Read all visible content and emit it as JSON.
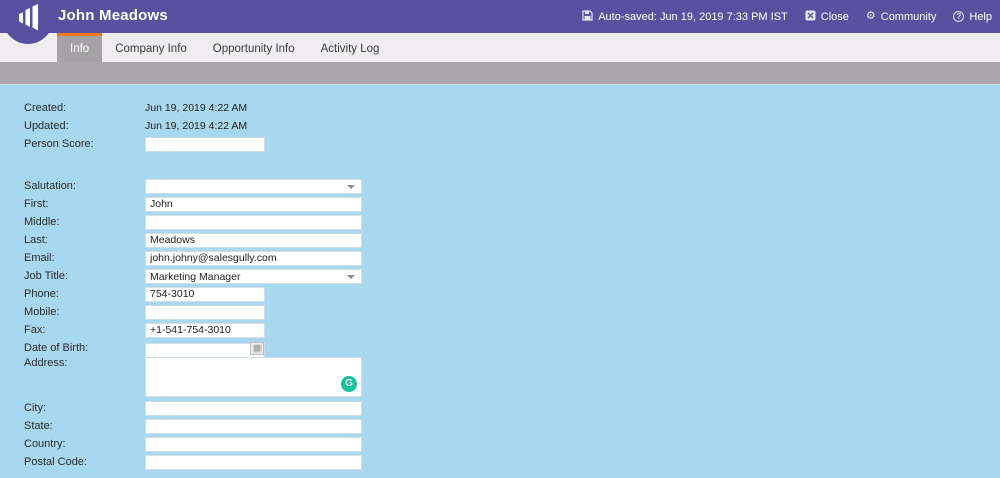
{
  "header": {
    "title": "John Meadows",
    "autosave_label": "Auto-saved: Jun 19, 2019 7:33 PM IST",
    "close_label": "Close",
    "community_label": "Community",
    "help_label": "Help"
  },
  "tabs": [
    {
      "label": "Info",
      "active": true
    },
    {
      "label": "Company Info",
      "active": false
    },
    {
      "label": "Opportunity Info",
      "active": false
    },
    {
      "label": "Activity Log",
      "active": false
    }
  ],
  "fields": {
    "created": {
      "label": "Created:",
      "value": "Jun 19, 2019 4:22 AM"
    },
    "updated": {
      "label": "Updated:",
      "value": "Jun 19, 2019 4:22 AM"
    },
    "person_score": {
      "label": "Person Score:",
      "value": ""
    },
    "salutation": {
      "label": "Salutation:",
      "value": ""
    },
    "first": {
      "label": "First:",
      "value": "John"
    },
    "middle": {
      "label": "Middle:",
      "value": ""
    },
    "last": {
      "label": "Last:",
      "value": "Meadows"
    },
    "email": {
      "label": "Email:",
      "value": "john.johny@salesgully.com"
    },
    "job_title": {
      "label": "Job Title:",
      "value": "Marketing Manager"
    },
    "phone": {
      "label": "Phone:",
      "value": "754-3010"
    },
    "mobile": {
      "label": "Mobile:",
      "value": ""
    },
    "fax": {
      "label": "Fax:",
      "value": "+1-541-754-3010"
    },
    "dob": {
      "label": "Date of Birth:",
      "value": ""
    },
    "address": {
      "label": "Address:",
      "value": ""
    },
    "city": {
      "label": "City:",
      "value": ""
    },
    "state": {
      "label": "State:",
      "value": ""
    },
    "country": {
      "label": "Country:",
      "value": ""
    },
    "postal_code": {
      "label": "Postal Code:",
      "value": ""
    }
  },
  "icons": {
    "logo": "marketo-logo",
    "autosave": "floppy-disk-icon",
    "close": "close-box-icon",
    "community": "gears-icon",
    "help": "question-circle-icon",
    "dob": "calendar-icon",
    "address": "grammarly-icon",
    "gear_glyph": "⚙",
    "close_glyph": "✕",
    "help_glyph": "?",
    "grammarly_glyph": "G"
  },
  "colors": {
    "header_purple": "#5a50a0",
    "active_tab_orange": "#e8791d",
    "active_tab_gray": "#a5a2a5",
    "tabbar_bg": "#efedf0",
    "toolbar_gray": "#a9a7aa",
    "form_blue": "#a8d8f0",
    "grammarly_green": "#15c39a"
  }
}
